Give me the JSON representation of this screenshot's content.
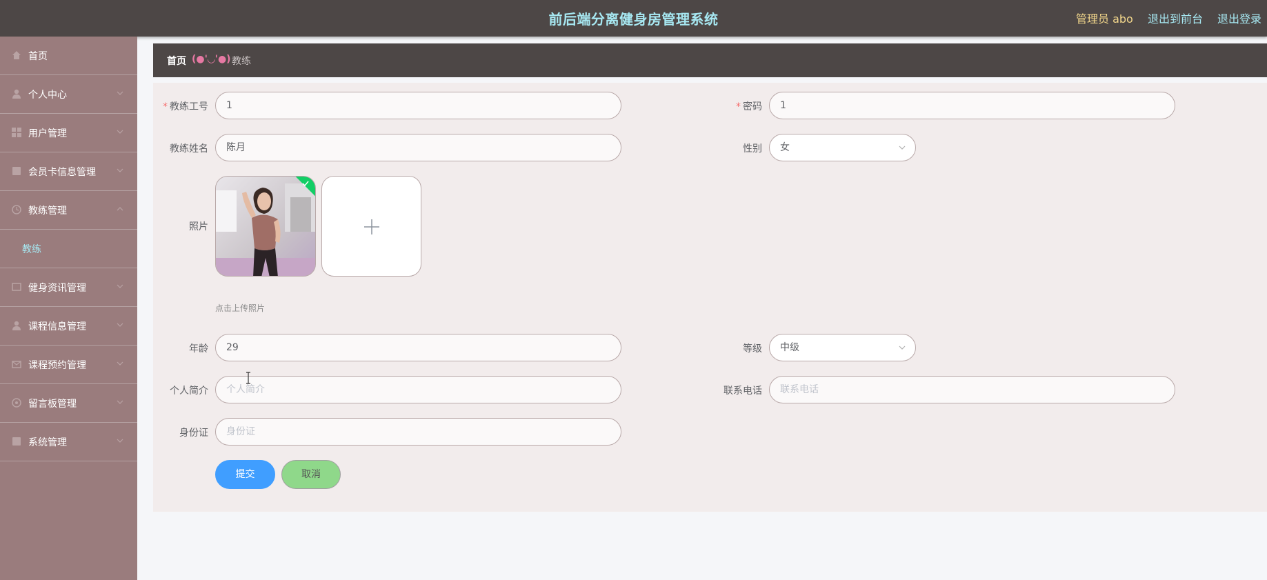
{
  "header": {
    "title": "前后端分离健身房管理系统",
    "admin": "管理员 abo",
    "link_front": "退出到前台",
    "link_logout": "退出登录"
  },
  "sidebar": {
    "items": [
      {
        "label": "首页",
        "icon": "home-icon",
        "has_arrow": false
      },
      {
        "label": "个人中心",
        "icon": "user-icon",
        "has_arrow": true
      },
      {
        "label": "用户管理",
        "icon": "grid-icon",
        "has_arrow": true
      },
      {
        "label": "会员卡信息管理",
        "icon": "card-icon",
        "has_arrow": true
      },
      {
        "label": "教练管理",
        "icon": "clock-icon",
        "has_arrow": true,
        "expanded": true
      },
      {
        "label": "健身资讯管理",
        "icon": "news-icon",
        "has_arrow": true
      },
      {
        "label": "课程信息管理",
        "icon": "user-icon",
        "has_arrow": true
      },
      {
        "label": "课程预约管理",
        "icon": "mail-icon",
        "has_arrow": true
      },
      {
        "label": "留言板管理",
        "icon": "message-icon",
        "has_arrow": true
      },
      {
        "label": "系统管理",
        "icon": "settings-icon",
        "has_arrow": true
      }
    ],
    "subitem": {
      "label": "教练"
    }
  },
  "breadcrumb": {
    "home": "首页",
    "separator": "(●'◡'●)",
    "current": "教练"
  },
  "form": {
    "coach_id": {
      "label": "教练工号",
      "value": "1",
      "required": true
    },
    "password": {
      "label": "密码",
      "value": "1",
      "required": true
    },
    "coach_name": {
      "label": "教练姓名",
      "value": "陈月"
    },
    "gender": {
      "label": "性别",
      "value": "女"
    },
    "photo": {
      "label": "照片",
      "hint": "点击上传照片"
    },
    "age": {
      "label": "年龄",
      "value": "29"
    },
    "level": {
      "label": "等级",
      "value": "中级"
    },
    "intro": {
      "label": "个人简介",
      "placeholder": "个人简介"
    },
    "phone": {
      "label": "联系电话",
      "placeholder": "联系电话"
    },
    "id_card": {
      "label": "身份证",
      "placeholder": "身份证"
    },
    "submit": "提交",
    "cancel": "取消"
  },
  "colors": {
    "header_bg": "#4d4746",
    "title": "#a7e8f2",
    "admin": "#f4d88c",
    "sidebar_bg": "#9a7c7d",
    "panel_bg": "#f2ecec",
    "primary": "#409eff",
    "cancel": "#8fd88a",
    "success": "#13ce66"
  }
}
